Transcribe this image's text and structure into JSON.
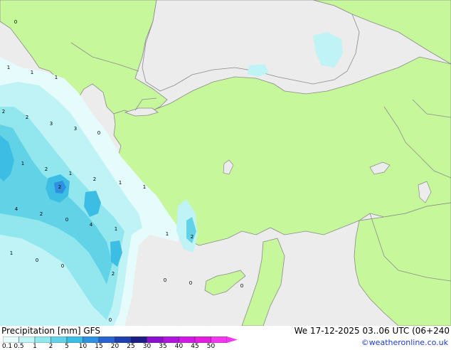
{
  "footer": {
    "title": "Precipitation [mm] GFS",
    "datetime": "We 17-12-2025 03..06 UTC (06+240",
    "copyright": "©weatheronline.co.uk"
  },
  "legend": {
    "ticks": [
      "0.1",
      "0.5",
      "1",
      "2",
      "5",
      "10",
      "15",
      "20",
      "25",
      "30",
      "35",
      "40",
      "45",
      "50"
    ],
    "colors": [
      "#e6fbfb",
      "#bff3f5",
      "#92e7ef",
      "#62d3e6",
      "#3cbde4",
      "#2f8fe0",
      "#2a63cf",
      "#2040b0",
      "#1a1f86",
      "#8a10cc",
      "#b015dc",
      "#cf1ae6",
      "#e21fe0",
      "#f038ee"
    ]
  },
  "map": {
    "colors": {
      "land": "#c6f79b",
      "sea": "#ececec",
      "border": "#8c8c8c",
      "coast": "#8a8a8a"
    },
    "labels": [
      "0",
      "1",
      "1",
      "1",
      "2",
      "2",
      "3",
      "3",
      "0",
      "1",
      "2",
      "1",
      "2",
      "1",
      "2",
      "1",
      "4",
      "2",
      "0",
      "4",
      "1",
      "1",
      "2",
      "1",
      "0",
      "0",
      "2",
      "0",
      "0",
      "0",
      "0"
    ]
  }
}
